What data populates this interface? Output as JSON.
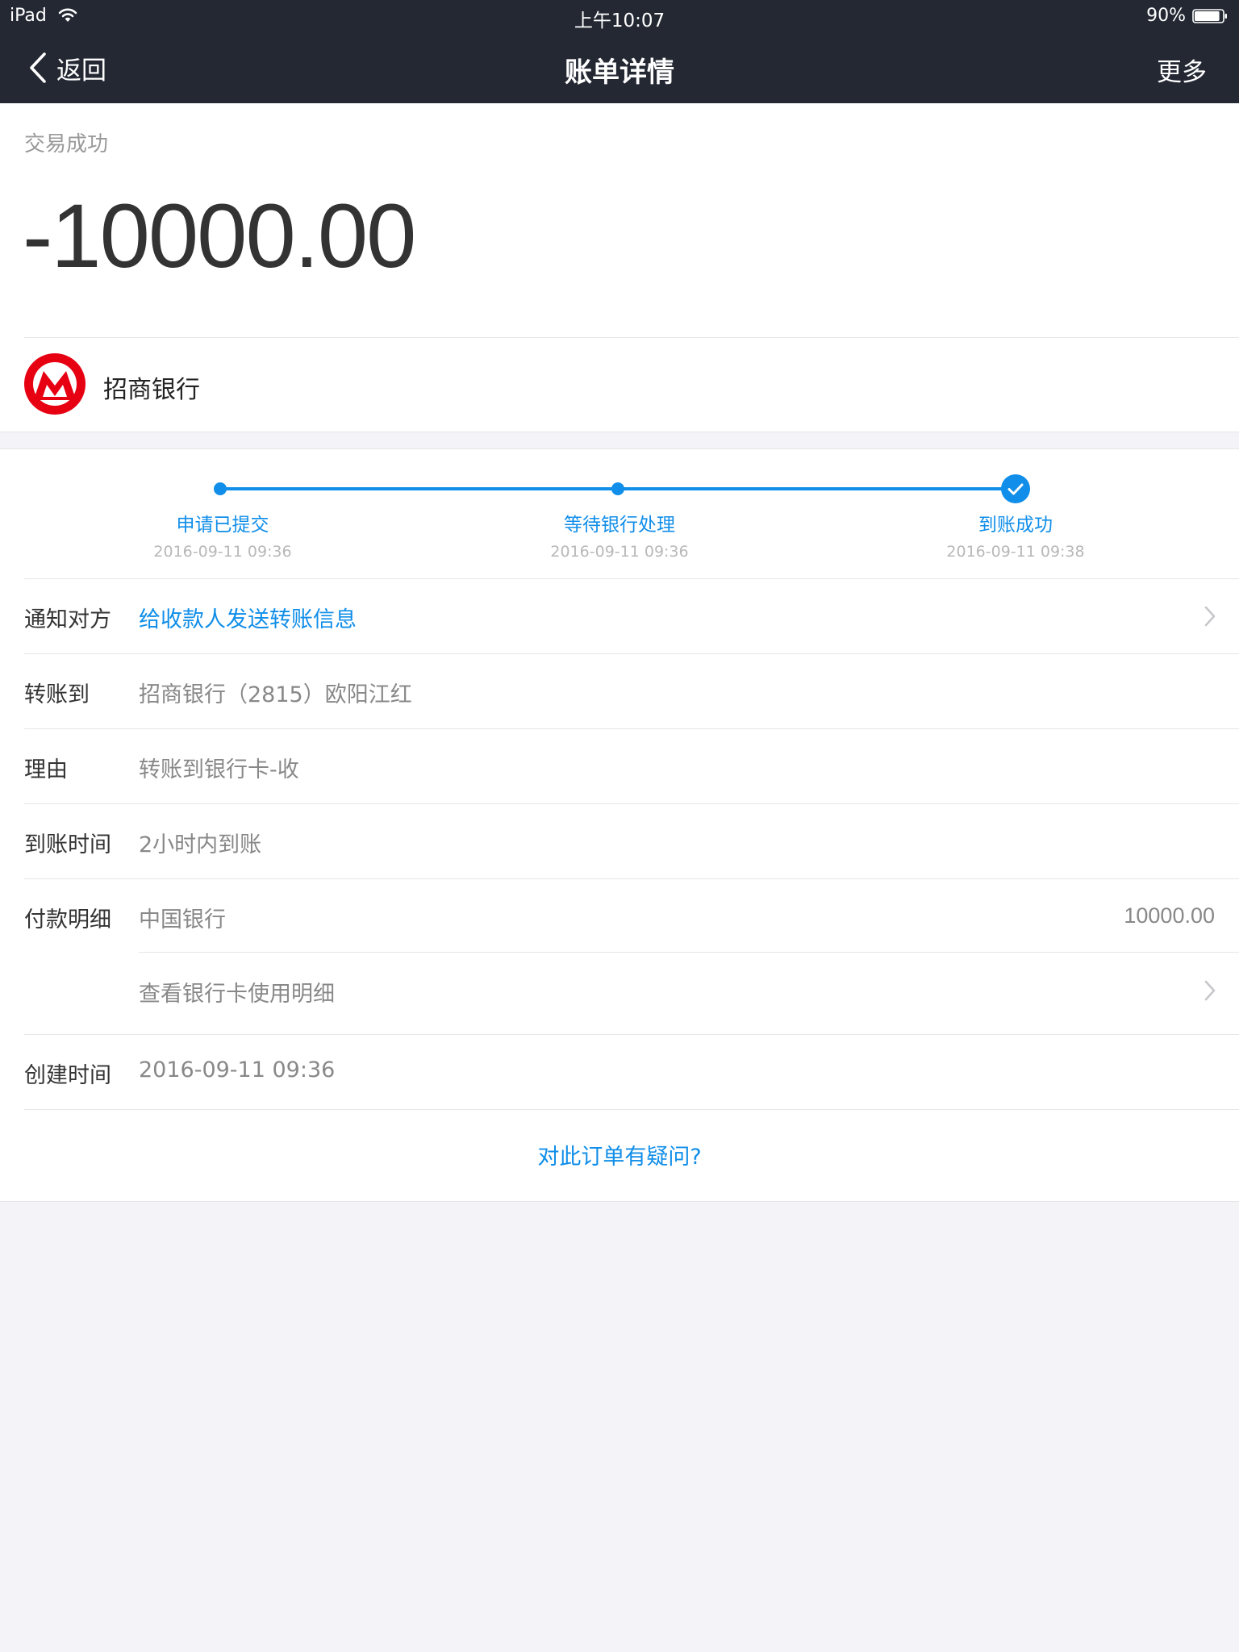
{
  "status_bar": {
    "device": "iPad",
    "time": "上午10:07",
    "battery_percent": "90%",
    "battery_level": 0.9,
    "wifi_icon": "wifi-icon",
    "battery_icon": "battery-icon"
  },
  "nav": {
    "back_label": "返回",
    "back_icon": "chevron-left-icon",
    "title": "账单详情",
    "more_label": "更多"
  },
  "summary": {
    "status": "交易成功",
    "amount": "-10000.00",
    "bank_name": "招商银行",
    "bank_logo_icon": "cmb-logo",
    "logo_color": "#e60012"
  },
  "progress": {
    "accent_color": "#108ee9",
    "steps": [
      {
        "label": "申请已提交",
        "time": "2016-09-11 09:36"
      },
      {
        "label": "等待银行处理",
        "time": "2016-09-11 09:36"
      },
      {
        "label": "到账成功",
        "time": "2016-09-11 09:38"
      }
    ]
  },
  "details": {
    "notify": {
      "label": "通知对方",
      "value": "给收款人发送转账信息"
    },
    "transfer_to": {
      "label": "转账到",
      "value": "招商银行（2815）欧阳江红"
    },
    "reason": {
      "label": "理由",
      "value": "转账到银行卡-收"
    },
    "arrival_time": {
      "label": "到账时间",
      "value": "2小时内到账"
    },
    "payment": {
      "label": "付款明细",
      "value": "中国银行",
      "amount": "10000.00"
    },
    "card_usage": {
      "value": "查看银行卡使用明细"
    },
    "created": {
      "label": "创建时间",
      "value": "2016-09-11 09:36"
    }
  },
  "footer": {
    "question_link": "对此订单有疑问?"
  }
}
